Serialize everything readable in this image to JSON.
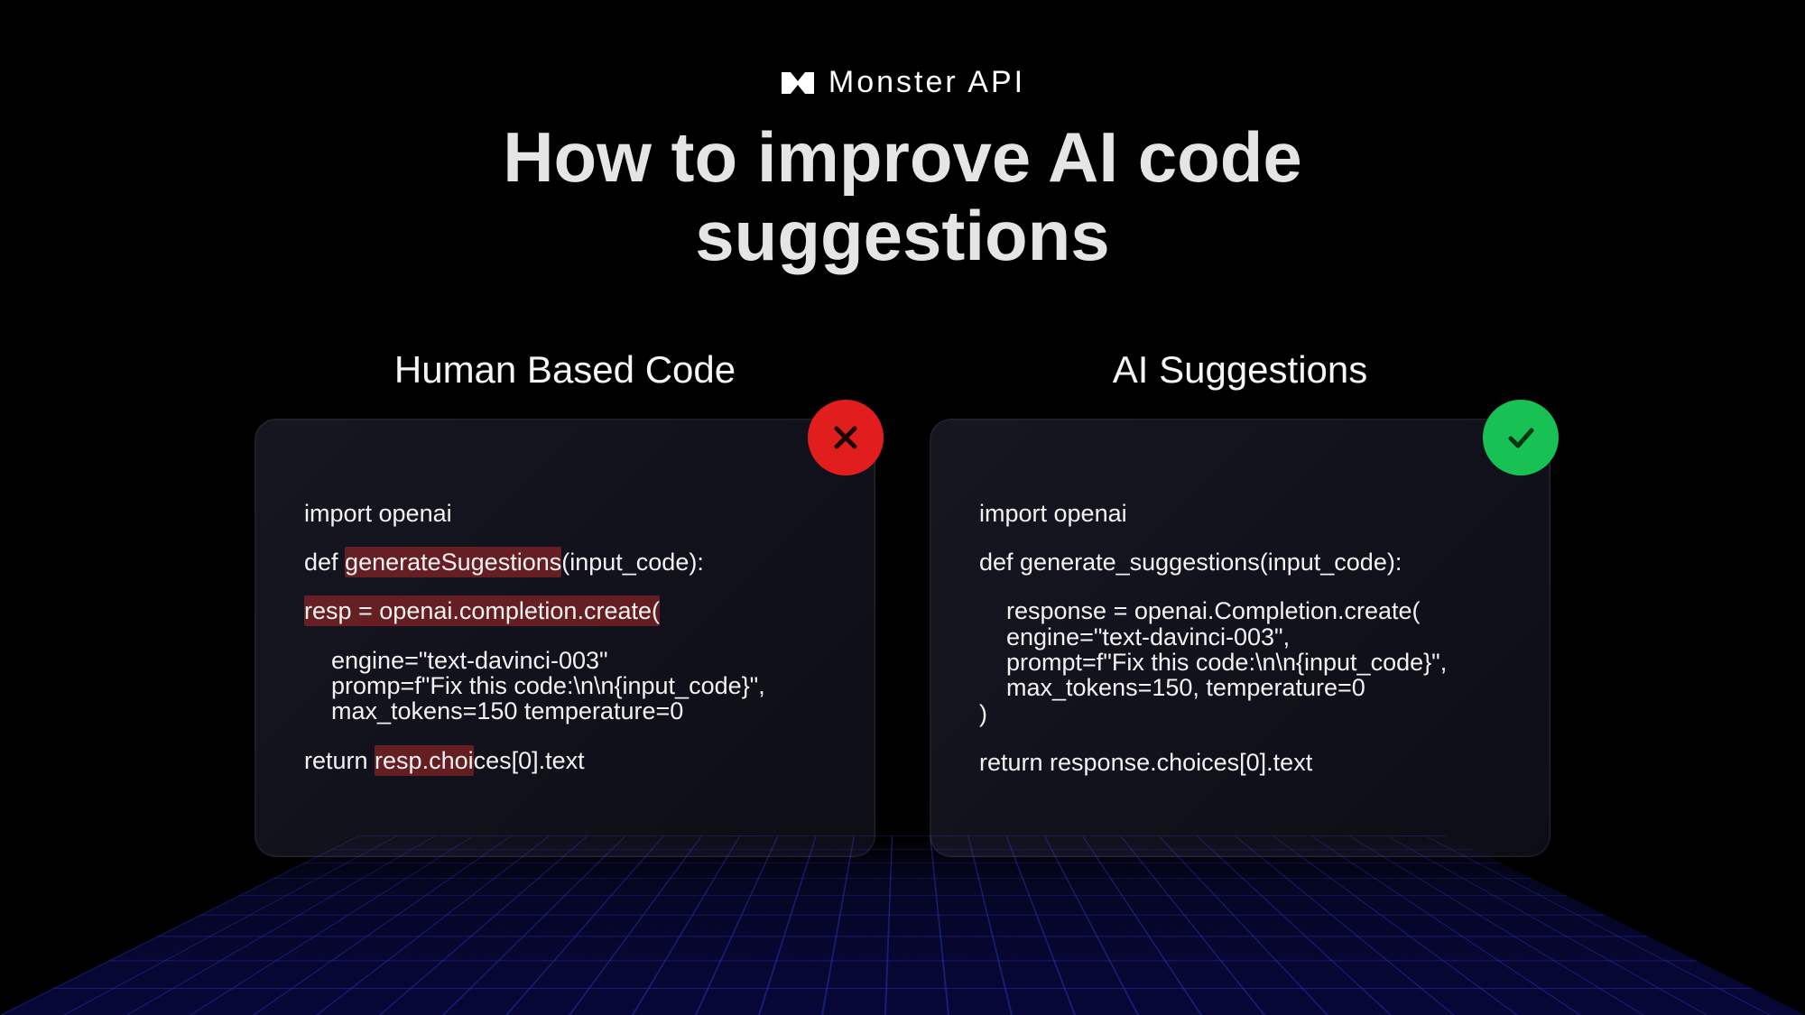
{
  "brand": {
    "name": "Monster API"
  },
  "title": "How to improve AI code suggestions",
  "left": {
    "heading": "Human Based Code",
    "badge": "x",
    "code": {
      "l1": "import openai",
      "l2a": "def ",
      "l2b_hl": "generateSugestions",
      "l2c": "(input_code):",
      "l3_hl": "resp = openai.completion.create(",
      "l4": "    engine=\"text-davinci-003\"",
      "l5": "    promp=f\"Fix this code:\\n\\n{input_code}\",",
      "l6": "    max_tokens=150 temperature=0",
      "l7a": "return ",
      "l7b_hl": "resp.choi",
      "l7c": "ces[0].text"
    }
  },
  "right": {
    "heading": "AI Suggestions",
    "badge": "check",
    "code": {
      "l1": "import openai",
      "l2": "def generate_suggestions(input_code):",
      "l3": "    response = openai.Completion.create(",
      "l4": "    engine=\"text-davinci-003\",",
      "l5": "    prompt=f\"Fix this code:\\n\\n{input_code}\",",
      "l6": "    max_tokens=150, temperature=0",
      "l7": ")",
      "l8": "return response.choices[0].text"
    }
  }
}
